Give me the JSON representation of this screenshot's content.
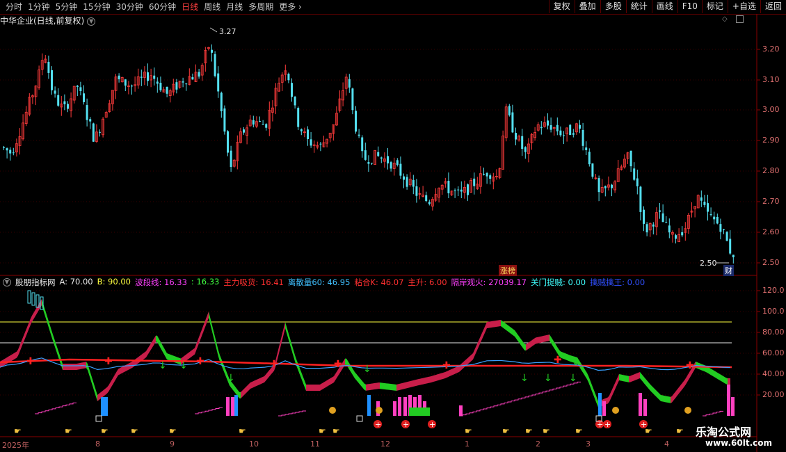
{
  "toolbar": {
    "tabs": [
      "分时",
      "1分钟",
      "5分钟",
      "15分钟",
      "30分钟",
      "60分钟",
      "日线",
      "周线",
      "月线",
      "多周期",
      "更多"
    ],
    "active_tab": "日线",
    "tools": [
      "复权",
      "叠加",
      "多股",
      "统计",
      "画线",
      "F10",
      "标记",
      "+自选",
      "返回"
    ]
  },
  "stock": {
    "title": "中华企业(日线,前复权)",
    "high_label": "3.27",
    "low_label": "2.50",
    "zhangbang": "涨榜",
    "cai": "财"
  },
  "price_axis": [
    "3.20",
    "3.10",
    "3.00",
    "2.90",
    "2.80",
    "2.70",
    "2.60",
    "2.50"
  ],
  "indicator": {
    "legend": [
      {
        "text": "股朋指标网",
        "color": "#e8e8e8"
      },
      {
        "text": "A: 70.00",
        "color": "#e8e8e8"
      },
      {
        "text": "B: 90.00",
        "color": "#ffff40"
      },
      {
        "text": "波段线: 16.33",
        "color": "#ff40ff"
      },
      {
        "text": ": 16.33",
        "color": "#40ff40"
      },
      {
        "text": "主力吸货: 16.41",
        "color": "#ff3030"
      },
      {
        "text": "离散量60: 46.95",
        "color": "#40c0ff"
      },
      {
        "text": "粘合K: 46.07",
        "color": "#ff3030"
      },
      {
        "text": "主升: 6.00",
        "color": "#ff3030"
      },
      {
        "text": "隔岸观火: 27039.17",
        "color": "#ff40ff"
      },
      {
        "text": "关门捉贼: 0.00",
        "color": "#40ffff"
      },
      {
        "text": "擒贼擒王: 0.00",
        "color": "#3050ff"
      }
    ],
    "axis": [
      "120.0",
      "100.0",
      "80.00",
      "60.00",
      "40.00",
      "20.00"
    ]
  },
  "x_axis": [
    {
      "label": "2025年"
    },
    {
      "label": "8"
    },
    {
      "label": "9"
    },
    {
      "label": "10"
    },
    {
      "label": "11"
    },
    {
      "label": "12"
    },
    {
      "label": "1"
    },
    {
      "label": "2"
    },
    {
      "label": "3"
    },
    {
      "label": "4"
    }
  ],
  "watermark": {
    "line1": "乐淘公式网",
    "line2": "www.60lt.com"
  },
  "colors": {
    "up": "#ff3b3b",
    "down": "#54e0f0",
    "ma": "#ff2020",
    "yellow": "#ffff40",
    "green": "#22cc22",
    "magenta": "#ff40c0"
  }
}
